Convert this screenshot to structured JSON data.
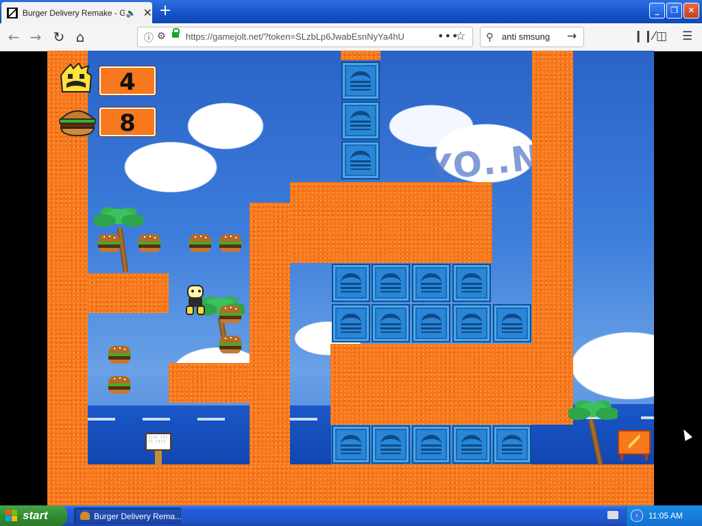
{
  "browser": {
    "tab_title": "Burger Delivery Remake - Gam",
    "url": "https://gamejolt.net/?token=SLzbLp6JwabEsnNyYa4hU",
    "search_query": "anti smsung",
    "icons": [
      "back-arrow-icon",
      "forward-arrow-icon",
      "reload-icon",
      "home-icon",
      "info-icon",
      "tracking-icon",
      "lock-icon",
      "page-actions-icon",
      "bookmark-star-icon",
      "search-icon",
      "go-arrow-icon",
      "library-icon",
      "sidebar-icon",
      "menu-icon",
      "speaker-icon",
      "close-icon",
      "new-tab-icon"
    ]
  },
  "window": {
    "minimize": "_",
    "restore": "❐",
    "close": "✕"
  },
  "hud": {
    "lives": "4",
    "burgers": "8"
  },
  "game": {
    "title": "Burger Delivery Remake",
    "background_text": "YO..N"
  },
  "taskbar": {
    "start_label": "start",
    "task_label": "Burger Delivery Rema...",
    "clock": "11:05 AM"
  },
  "colors": {
    "wall": "#f7781d",
    "block": "#2a86d6",
    "sky": "#3c7ddb",
    "sea": "#1a57c9",
    "taskbar": "#245edb",
    "start": "#2f8c2f"
  }
}
